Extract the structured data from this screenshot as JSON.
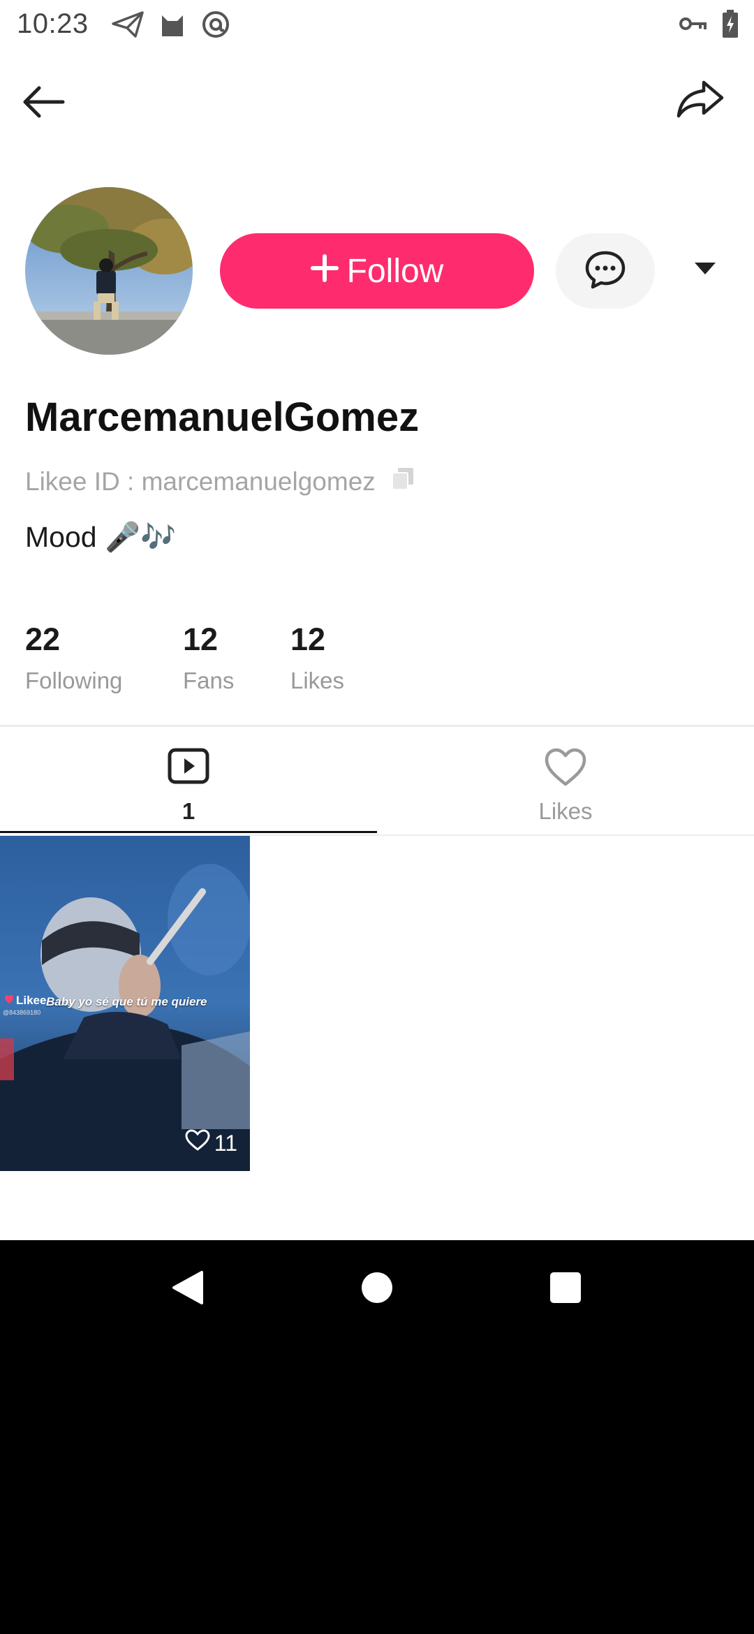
{
  "status_bar": {
    "time": "10:23",
    "left_icons": [
      "send-icon",
      "cat-icon",
      "at-sign-icon"
    ],
    "right_icons": [
      "key-icon",
      "battery-charging-icon"
    ]
  },
  "toolbar": {
    "back_icon": "arrow-left-icon",
    "share_icon": "share-arrow-icon"
  },
  "profile": {
    "follow_label": "Follow",
    "follow_color": "#fe2c6f",
    "username": "MarcemanuelGomez",
    "likee_id": "Likee ID : marcemanuelgomez",
    "bio": "Mood 🎤🎶"
  },
  "stats": [
    {
      "value": "22",
      "label": "Following"
    },
    {
      "value": "12",
      "label": "Fans"
    },
    {
      "value": "12",
      "label": "Likes"
    }
  ],
  "tabs": [
    {
      "label": "1",
      "icon": "video-play-icon",
      "active": true
    },
    {
      "label": "Likes",
      "icon": "heart-outline-icon",
      "active": false
    }
  ],
  "videos": [
    {
      "caption": "Baby yo sé que tú me quiere",
      "watermark": "Likee",
      "watermark_id": "@843869180",
      "likes": "11"
    }
  ],
  "nav_bar": {
    "buttons": [
      "back-triangle-icon",
      "home-circle-icon",
      "recents-square-icon"
    ]
  }
}
